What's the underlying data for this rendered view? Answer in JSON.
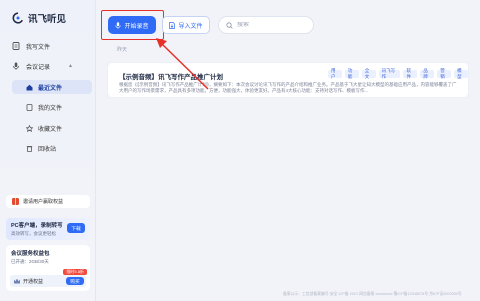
{
  "app": {
    "name": "讯飞听见"
  },
  "sidebar": {
    "items": [
      {
        "label": "我写文件",
        "icon": "document-icon"
      },
      {
        "label": "会议记录",
        "icon": "microphone-icon"
      }
    ],
    "sub_items": [
      {
        "label": "最近文件",
        "icon": "home-icon"
      },
      {
        "label": "我的文件",
        "icon": "document-icon"
      },
      {
        "label": "收藏文件",
        "icon": "star-icon"
      },
      {
        "label": "回收站",
        "icon": "trash-icon"
      }
    ],
    "upgrade_label": "邀请用户赢取权益",
    "pc_card": {
      "title": "PC客户端，录制转写",
      "subtitle": "高效转写，会议更轻松",
      "download_label": "下载"
    },
    "member_card": {
      "title": "会议服务权益包",
      "subtitle": "已开通：2GB/30天",
      "row_label": "开通权益",
      "buy_label": "购买",
      "promo_label": "限时5.8折"
    }
  },
  "toolbar": {
    "record_label": "开始录音",
    "import_label": "导入文件",
    "search_placeholder": "搜索"
  },
  "main": {
    "section_label": "昨天",
    "files": [
      {
        "title": "【示例音频】讯飞写作产品推广计划",
        "summary": "根据您《【示例音频】讯飞写作产品推广计划》，摘要如下：本次会议讨论讯飞写作的产品介绍和推广业务。产品基于飞大星让知大模型的基础应用产品，内容能够覆盖了广大用户的写作场景需求，产品具有多项功能，方便，功能强大，体验更友好。产品有4大核心功能：支持对话写作、模板写作...",
        "tags": [
          "用户",
          "功能",
          "全文",
          "讯飞写作",
          "软件",
          "品牌",
          "营销",
          "模型"
        ]
      }
    ]
  },
  "footer": {
    "text": "备案公示：工信部备案编号·安全 ICP备 2021 网信备案 xxxxxxxxx 蜀ICP备12345678号 京ICP证0000000号"
  },
  "colors": {
    "accent": "#2f6bf5",
    "highlight": "#e8302a"
  }
}
